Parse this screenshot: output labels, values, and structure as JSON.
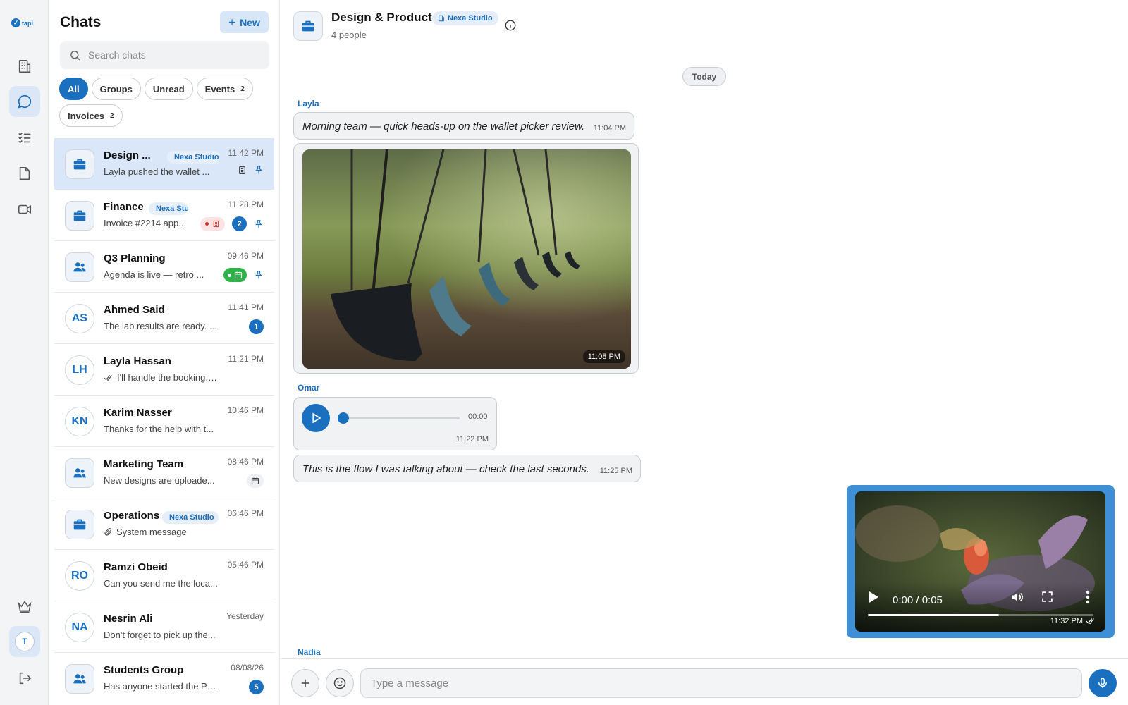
{
  "app": {
    "logo_text": "tapi",
    "accent": "#1a6fbf"
  },
  "rail": {
    "items": [
      {
        "icon": "building-icon"
      },
      {
        "icon": "chat-icon",
        "active": true
      },
      {
        "icon": "checklist-icon"
      },
      {
        "icon": "file-icon"
      },
      {
        "icon": "video-icon"
      }
    ],
    "bottom": [
      {
        "icon": "crown-icon"
      },
      {
        "icon": "logout-icon"
      }
    ],
    "user_initial": "T"
  },
  "panel": {
    "title": "Chats",
    "new_label": "New",
    "search_placeholder": "Search chats",
    "filters": [
      {
        "label": "All",
        "active": true,
        "count": ""
      },
      {
        "label": "Groups",
        "count": ""
      },
      {
        "label": "Unread",
        "count": ""
      },
      {
        "label": "Events",
        "count": "2"
      },
      {
        "label": "Invoices",
        "count": "2"
      }
    ]
  },
  "chats": [
    {
      "name": "Design ...",
      "org": "Nexa Studio",
      "time": "11:42 PM",
      "preview": "Layla pushed the wallet ...",
      "avatar": "briefcase",
      "active": true
    },
    {
      "name": "Finance",
      "org": "Nexa Studio",
      "time": "11:28 PM",
      "preview": "Invoice #2214 app...",
      "avatar": "briefcase",
      "badge": "2"
    },
    {
      "name": "Q3 Planning",
      "time": "09:46 PM",
      "preview": "Agenda is live — retro ...",
      "avatar": "group"
    },
    {
      "name": "Ahmed Said",
      "time": "11:41 PM",
      "preview": "The lab results are ready. ...",
      "initials": "AS",
      "badge": "1"
    },
    {
      "name": "Layla Hassan",
      "time": "11:21 PM",
      "preview": "I'll handle the booking. ...",
      "initials": "LH"
    },
    {
      "name": "Karim Nasser",
      "time": "10:46 PM",
      "preview": "Thanks for the help with t...",
      "initials": "KN"
    },
    {
      "name": "Marketing Team",
      "time": "08:46 PM",
      "preview": "New designs are uploade...",
      "avatar": "group"
    },
    {
      "name": "Operations",
      "org": "Nexa Studio",
      "time": "06:46 PM",
      "preview": "System message",
      "avatar": "briefcase"
    },
    {
      "name": "Ramzi Obeid",
      "time": "05:46 PM",
      "preview": "Can you send me the loca...",
      "initials": "RO"
    },
    {
      "name": "Nesrin Ali",
      "time": "Yesterday",
      "preview": "Don't forget to pick up the...",
      "initials": "NA"
    },
    {
      "name": "Students Group",
      "time": "08/08/26",
      "preview": "Has anyone started the Ph...",
      "avatar": "group",
      "badge": "5"
    }
  ],
  "conversation": {
    "title": "Design & Product",
    "org": "Nexa Studio",
    "subtitle": "4 people",
    "day_label": "Today",
    "messages": {
      "m1": {
        "sender": "Layla",
        "text": "Morning team — quick heads-up on the wallet picker review.",
        "time": "11:04 PM"
      },
      "m2": {
        "time": "11:08 PM"
      },
      "m3": {
        "sender": "Omar",
        "duration": "00:00",
        "time": "11:22 PM"
      },
      "m4": {
        "text": "This is the flow I was talking about — check the last seconds.",
        "time": "11:25 PM"
      },
      "m5": {
        "video_time": "0:00 / 0:05",
        "progress": 0.58,
        "time": "11:32 PM"
      },
      "m6": {
        "sender": "Nadia"
      }
    }
  },
  "composer": {
    "placeholder": "Type a message"
  }
}
